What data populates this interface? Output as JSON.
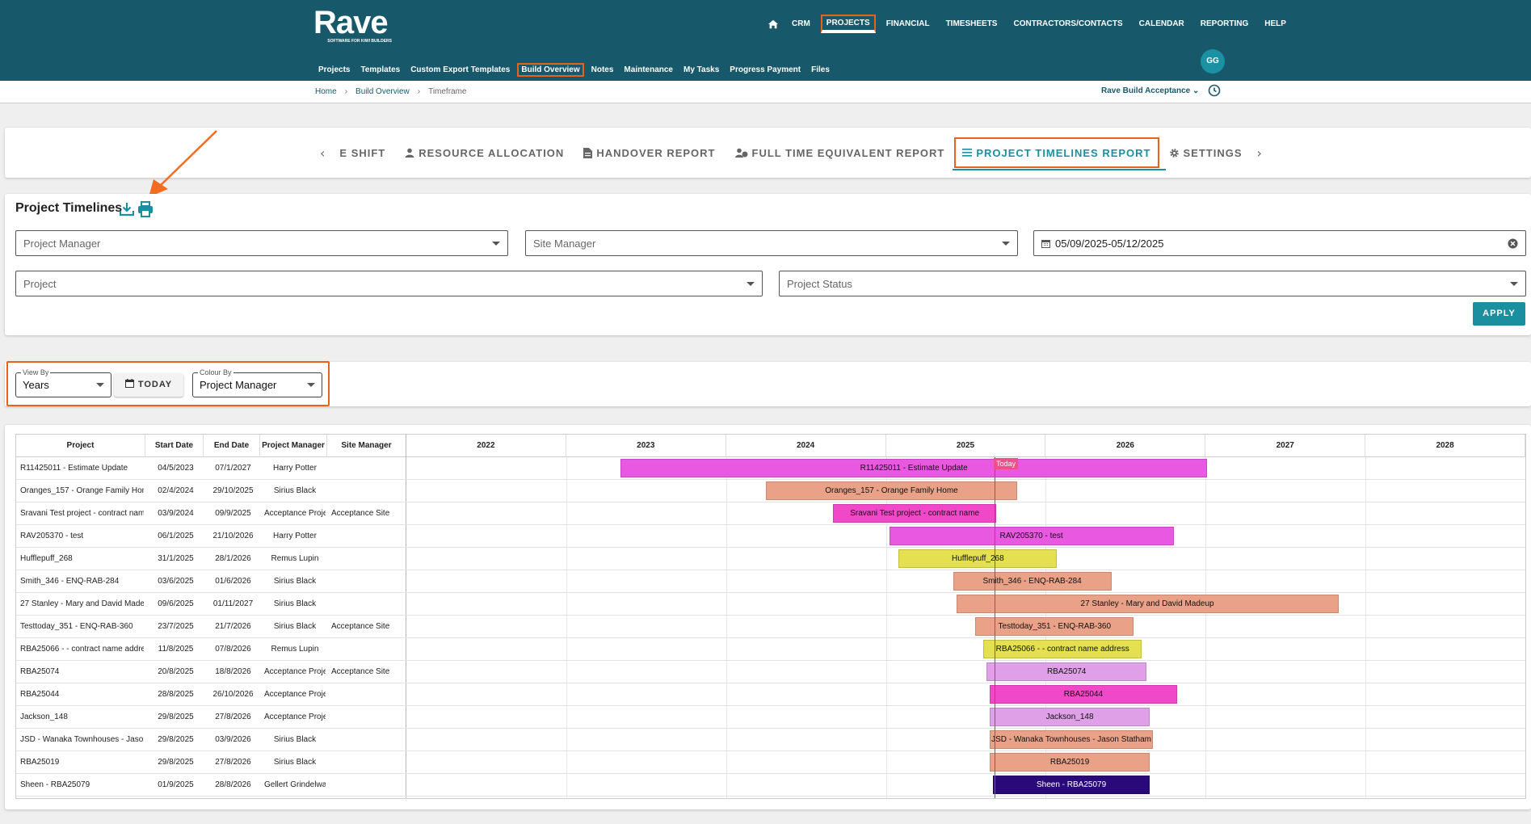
{
  "app": {
    "logo_text": "Rave",
    "logo_tagline": "SOFTWARE FOR KIWI BUILDERS"
  },
  "mainnav": [
    "CRM",
    "PROJECTS",
    "FINANCIAL",
    "TIMESHEETS",
    "CONTRACTORS/CONTACTS",
    "CALENDAR",
    "REPORTING",
    "HELP"
  ],
  "subnav": [
    "Projects",
    "Templates",
    "Custom Export Templates",
    "Build Overview",
    "Notes",
    "Maintenance",
    "My Tasks",
    "Progress Payment",
    "Files"
  ],
  "avatar": "GG",
  "breadcrumb": {
    "home": "Home",
    "section": "Build Overview",
    "current": "Timeframe"
  },
  "account_selector": "Rave Build Acceptance",
  "tabs": [
    "E SHIFT",
    "RESOURCE ALLOCATION",
    "HANDOVER REPORT",
    "FULL TIME EQUIVALENT REPORT",
    "PROJECT TIMELINES REPORT",
    "SETTINGS"
  ],
  "filters": {
    "title": "Project Timelines",
    "project_manager_placeholder": "Project Manager",
    "site_manager_placeholder": "Site Manager",
    "date_range": "05/09/2025-05/12/2025",
    "project_placeholder": "Project",
    "project_status_placeholder": "Project Status",
    "apply_label": "APPLY"
  },
  "view_controls": {
    "view_by_label": "View By",
    "view_by_value": "Years",
    "today_label": "TODAY",
    "colour_by_label": "Colour By",
    "colour_by_value": "Project Manager"
  },
  "gantt": {
    "columns": [
      "Project",
      "Start Date",
      "End Date",
      "Project Manager",
      "Site Manager"
    ],
    "years": [
      "2022",
      "2023",
      "2024",
      "2025",
      "2026",
      "2027",
      "2028"
    ],
    "year_start": 2022,
    "year_end": 2029,
    "today_label": "Today",
    "today_value": 2025.68,
    "rows": [
      {
        "project": "R11425011 - Estimate Update",
        "start": "04/5/2023",
        "end": "07/1/2027",
        "pm": "Harry Potter",
        "sm": "",
        "bar": "R11425011 - Estimate Update",
        "s": 2023.34,
        "e": 2027.01,
        "color": "#e858e0"
      },
      {
        "project": "Oranges_157 - Orange Family Home",
        "start": "02/4/2024",
        "end": "29/10/2025",
        "pm": "Sirius Black",
        "sm": "",
        "bar": "Oranges_157 - Orange Family Home",
        "s": 2024.25,
        "e": 2025.82,
        "color": "#e9a187"
      },
      {
        "project": "Sravani Test project - contract name",
        "start": "03/9/2024",
        "end": "09/9/2025",
        "pm": "Acceptance Project",
        "sm": "Acceptance Site",
        "bar": "Sravani Test project - contract name",
        "s": 2024.67,
        "e": 2025.69,
        "color": "#f048c8"
      },
      {
        "project": "RAV205370 - test",
        "start": "06/1/2025",
        "end": "21/10/2026",
        "pm": "Harry Potter",
        "sm": "",
        "bar": "RAV205370 - test",
        "s": 2025.02,
        "e": 2026.8,
        "color": "#e858e0"
      },
      {
        "project": "Hufflepuff_268",
        "start": "31/1/2025",
        "end": "28/1/2026",
        "pm": "Remus Lupin",
        "sm": "",
        "bar": "Hufflepuff_268",
        "s": 2025.08,
        "e": 2026.07,
        "color": "#e4e050"
      },
      {
        "project": "Smith_346 - ENQ-RAB-284",
        "start": "03/6/2025",
        "end": "01/6/2026",
        "pm": "Sirius Black",
        "sm": "",
        "bar": "Smith_346 - ENQ-RAB-284",
        "s": 2025.42,
        "e": 2026.41,
        "color": "#e9a187"
      },
      {
        "project": "27 Stanley - Mary and David Madeup",
        "start": "09/6/2025",
        "end": "01/11/2027",
        "pm": "Sirius Black",
        "sm": "",
        "bar": "27 Stanley - Mary and David Madeup",
        "s": 2025.44,
        "e": 2027.83,
        "color": "#e9a187"
      },
      {
        "project": "Testtoday_351 - ENQ-RAB-360",
        "start": "23/7/2025",
        "end": "21/7/2026",
        "pm": "Sirius Black",
        "sm": "Acceptance Site",
        "bar": "Testtoday_351 - ENQ-RAB-360",
        "s": 2025.56,
        "e": 2026.55,
        "color": "#e9a187"
      },
      {
        "project": "RBA25066 - - contract name address",
        "start": "11/8/2025",
        "end": "07/8/2026",
        "pm": "Remus Lupin",
        "sm": "",
        "bar": "RBA25066 - - contract name address",
        "s": 2025.61,
        "e": 2026.6,
        "color": "#e4e050"
      },
      {
        "project": "RBA25074",
        "start": "20/8/2025",
        "end": "18/8/2026",
        "pm": "Acceptance Project",
        "sm": "Acceptance Site",
        "bar": "RBA25074",
        "s": 2025.63,
        "e": 2026.63,
        "color": "#e0a0e8"
      },
      {
        "project": "RBA25044",
        "start": "28/8/2025",
        "end": "26/10/2026",
        "pm": "Acceptance Project",
        "sm": "",
        "bar": "RBA25044",
        "s": 2025.65,
        "e": 2026.82,
        "color": "#f048c8"
      },
      {
        "project": "Jackson_148",
        "start": "29/8/2025",
        "end": "27/8/2026",
        "pm": "Acceptance Project",
        "sm": "",
        "bar": "Jackson_148",
        "s": 2025.65,
        "e": 2026.65,
        "color": "#e0a0e8"
      },
      {
        "project": "JSD - Wanaka Townhouses - Jason Statham",
        "start": "29/8/2025",
        "end": "03/9/2026",
        "pm": "Sirius Black",
        "sm": "",
        "bar": "JSD - Wanaka Townhouses - Jason Statham",
        "s": 2025.65,
        "e": 2026.67,
        "color": "#e9a187"
      },
      {
        "project": "RBA25019",
        "start": "29/8/2025",
        "end": "27/8/2026",
        "pm": "Sirius Black",
        "sm": "",
        "bar": "RBA25019",
        "s": 2025.65,
        "e": 2026.65,
        "color": "#e9a187"
      },
      {
        "project": "Sheen - RBA25079",
        "start": "01/9/2025",
        "end": "28/8/2026",
        "pm": "Gellert Grindelwald",
        "sm": "",
        "bar": "Sheen - RBA25079",
        "s": 2025.67,
        "e": 2026.65,
        "color": "#2a0a78",
        "textcolor": "#ffffff"
      }
    ]
  },
  "colors": {
    "brand": "#17586b",
    "accent": "#1a8fa0",
    "highlight": "#e8621c"
  }
}
